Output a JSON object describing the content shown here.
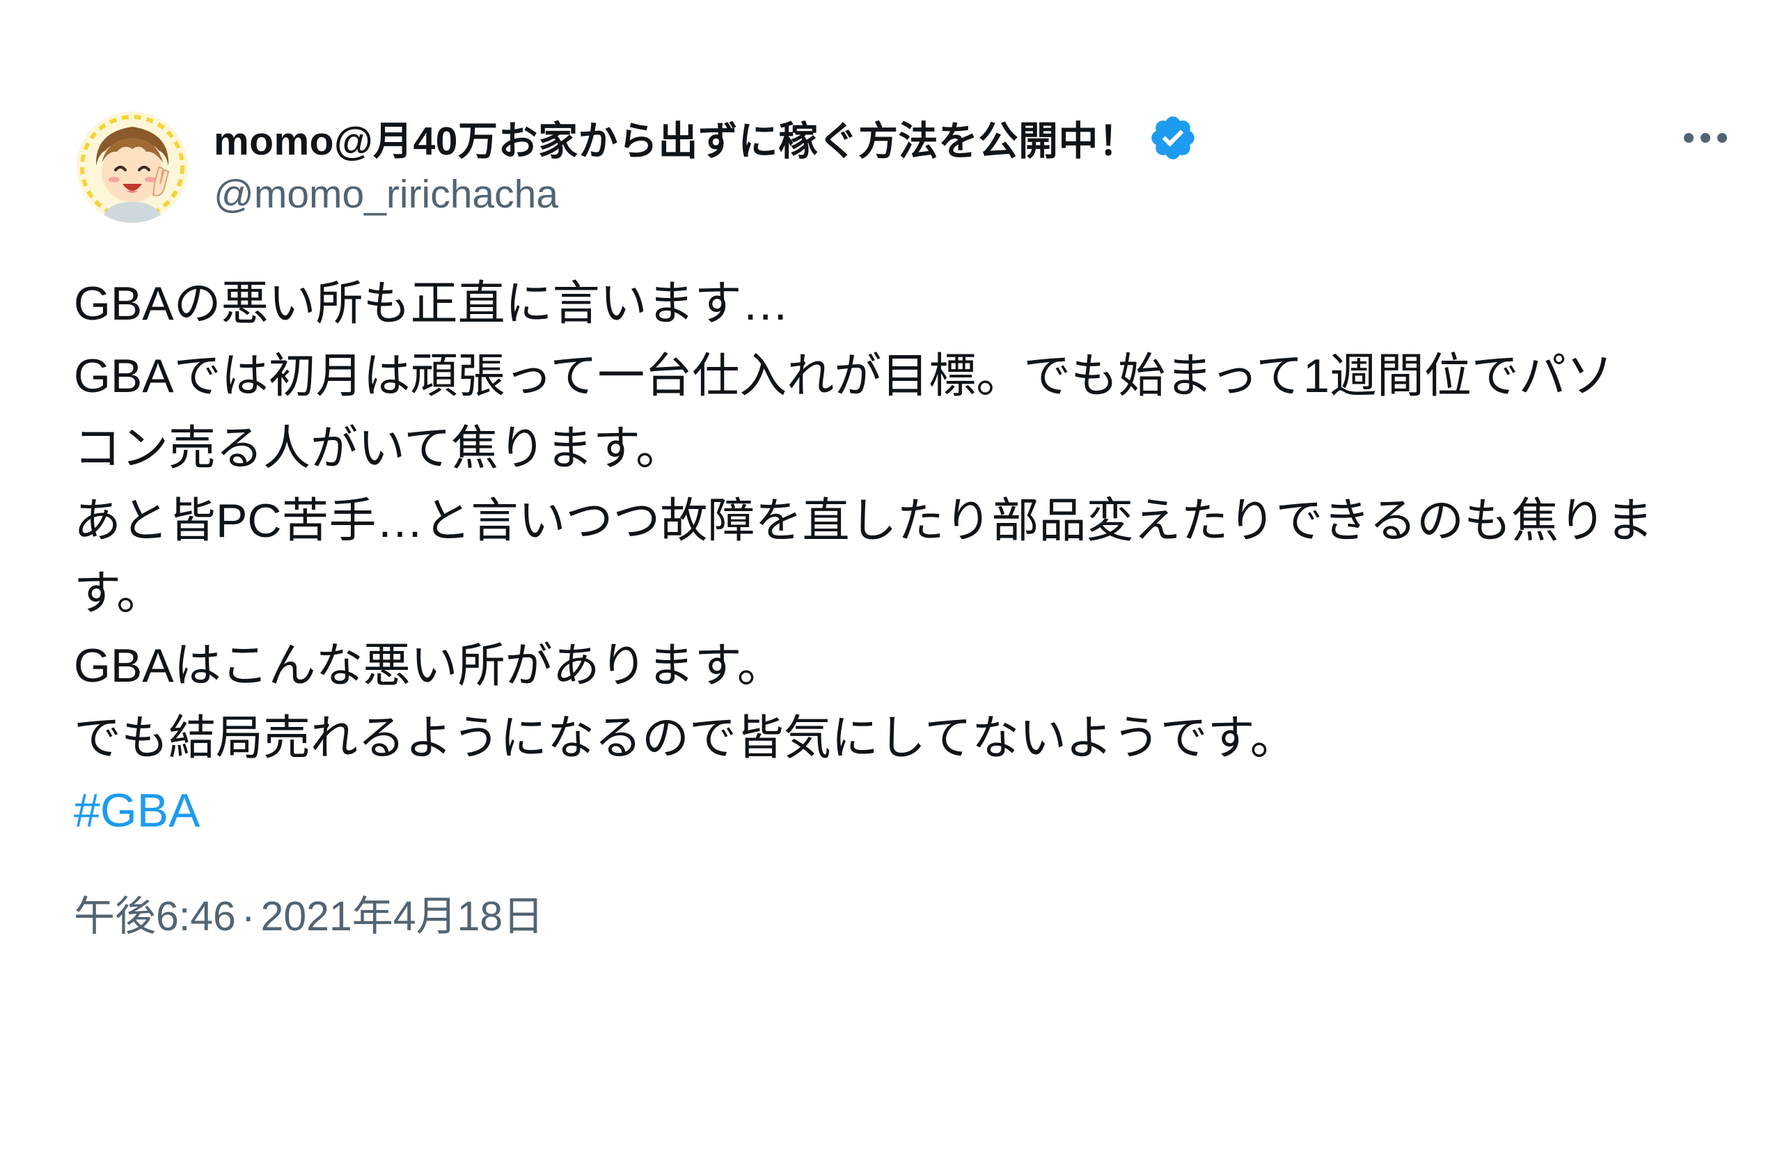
{
  "author": {
    "display_name": "momo@月40万お家から出ずに稼ぐ方法を公開中！",
    "handle": "@momo_ririchacha",
    "avatar_icon": "avatar-illustration-icon",
    "verified_icon": "verified-badge-icon"
  },
  "menu": {
    "more_icon": "more-options-icon"
  },
  "tweet": {
    "lines": [
      "GBAの悪い所も正直に言います…",
      "GBAでは初月は頑張って一台仕入れが目標。でも始まって1週間位でパソ",
      "コン売る人がいて焦ります。",
      "あと皆PC苦手…と言いつつ故障を直したり部品変えたりできるのも焦りま",
      "す。",
      "GBAはこんな悪い所があります。",
      "でも結局売れるようになるので皆気にしてないようです。"
    ],
    "hashtag": "#GBA"
  },
  "meta": {
    "time": "午後6:46",
    "separator": "·",
    "date": "2021年4月18日"
  },
  "colors": {
    "text": "#0f1419",
    "secondary": "#536471",
    "accent": "#1d9bf0",
    "verified": "#1d9bf0"
  }
}
